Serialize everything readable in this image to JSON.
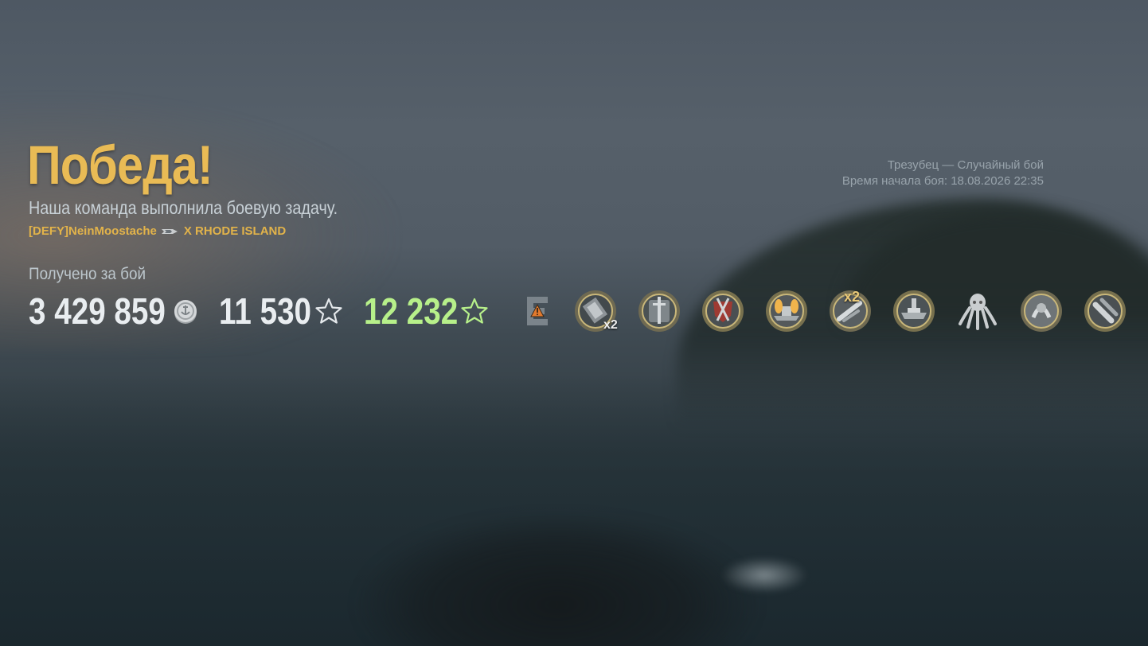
{
  "result": {
    "title": "Победа!",
    "subtitle": "Наша команда выполнила боевую задачу.",
    "player_name": "[DEFY]NeinMoostache",
    "ship": "X RHODE ISLAND"
  },
  "battle_info": {
    "line1": "Трезубец — Случайный бой",
    "line2": "Время начала боя: 18.08.2026 22:35"
  },
  "earned": {
    "label": "Получено за бой",
    "credits": "3 429 859",
    "xp": "11 530",
    "free_xp": "12 232"
  },
  "colors": {
    "title_gold": "#e9bb55",
    "bonus_green": "#b7f08a"
  },
  "achievements": [
    {
      "icon": "shell-hits-medal-icon",
      "multiplier": "x2"
    },
    {
      "icon": "sword-medal-icon",
      "multiplier": ""
    },
    {
      "icon": "red-shield-medal-icon",
      "multiplier": ""
    },
    {
      "icon": "burning-ship-medal-icon",
      "multiplier": ""
    },
    {
      "icon": "torpedo-medal-icon",
      "multiplier": "x2"
    },
    {
      "icon": "warship-medal-icon",
      "multiplier": ""
    },
    {
      "icon": "kraken-medal-icon",
      "multiplier": ""
    },
    {
      "icon": "confederate-medal-icon",
      "multiplier": ""
    },
    {
      "icon": "shells-medal-icon",
      "multiplier": ""
    }
  ]
}
